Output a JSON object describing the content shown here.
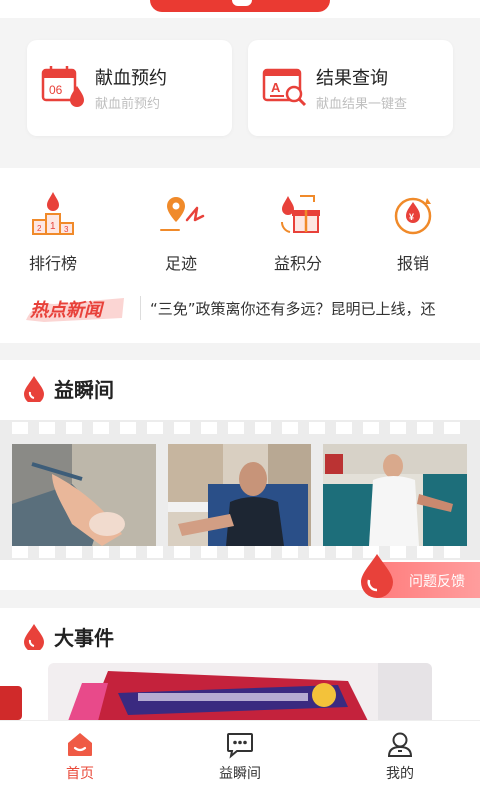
{
  "colors": {
    "accent": "#ea3a32",
    "active_nav": "#e94a3a",
    "icon_orange": "#f08a2a"
  },
  "services": [
    {
      "title": "献血预约",
      "subtitle": "献血前预约",
      "icon": "calendar-drop-icon"
    },
    {
      "title": "结果查询",
      "subtitle": "献血结果一键查",
      "icon": "report-search-icon"
    }
  ],
  "quick_actions": [
    {
      "label": "排行榜",
      "icon": "podium-icon"
    },
    {
      "label": "足迹",
      "icon": "footprint-location-icon"
    },
    {
      "label": "益积分",
      "icon": "gift-points-icon"
    },
    {
      "label": "报销",
      "icon": "yuan-reimburse-icon"
    }
  ],
  "news": {
    "badge": "热点新闻",
    "headline": "“三免”政策离你还有多远？昆明已上线，还"
  },
  "sections": {
    "moments": "益瞬间",
    "events": "大事件"
  },
  "feedback_label": "问题反馈",
  "bottom_nav": [
    {
      "label": "首页",
      "icon": "home-icon",
      "active": true
    },
    {
      "label": "益瞬间",
      "icon": "chat-bubble-icon",
      "active": false
    },
    {
      "label": "我的",
      "icon": "user-icon",
      "active": false
    }
  ]
}
